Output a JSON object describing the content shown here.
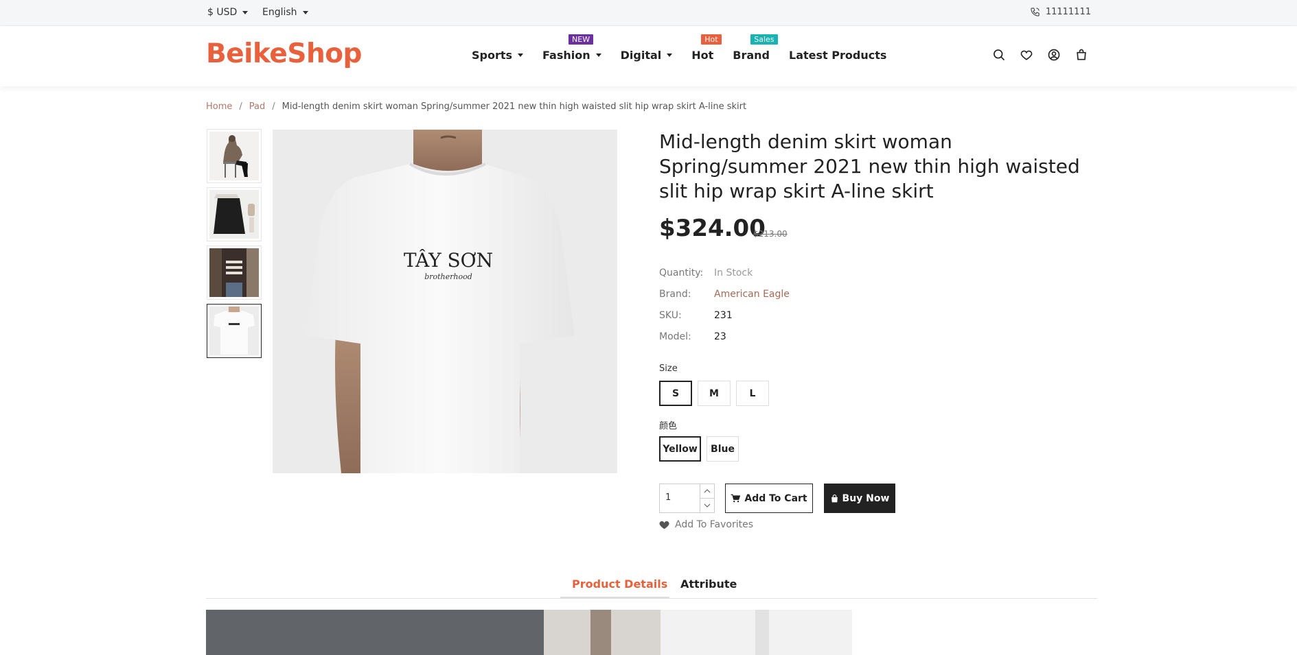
{
  "topbar": {
    "currency": "$ USD",
    "language": "English",
    "phone": "11111111"
  },
  "header": {
    "logo": "BeikeShop",
    "nav": [
      {
        "label": "Sports",
        "dropdown": true
      },
      {
        "label": "Fashion",
        "dropdown": true,
        "badge": "NEW"
      },
      {
        "label": "Digital",
        "dropdown": true
      },
      {
        "label": "Hot",
        "badge": "Hot"
      },
      {
        "label": "Brand",
        "badge": "Sales"
      },
      {
        "label": "Latest Products"
      }
    ],
    "icons": [
      "search-icon",
      "heart-icon",
      "user-icon",
      "cart-icon"
    ]
  },
  "breadcrumb": {
    "home": "Home",
    "sep": "/",
    "category": "Pad",
    "current": "Mid-length denim skirt woman Spring/summer 2021 new thin high waisted slit hip wrap skirt A-line skirt"
  },
  "product": {
    "title": "Mid-length denim skirt woman Spring/summer 2021 new thin high waisted slit hip wrap skirt A-line skirt",
    "price": "$324.00",
    "old_price": "$213.00",
    "image_text": "TÂY SƠN",
    "image_subtext": "brotherhood",
    "attributes": {
      "quantity_label": "Quantity:",
      "quantity_value": "In Stock",
      "brand_label": "Brand:",
      "brand_value": "American Eagle",
      "sku_label": "SKU:",
      "sku_value": "231",
      "model_label": "Model:",
      "model_value": "23"
    },
    "size_label": "Size",
    "sizes": [
      "S",
      "M",
      "L"
    ],
    "selected_size": "S",
    "color_label": "颜色",
    "colors": [
      "Yellow",
      "Blue"
    ],
    "selected_color": "Yellow",
    "quantity": "1",
    "add_to_cart": "Add To Cart",
    "buy_now": "Buy Now",
    "add_to_favorites": "Add To Favorites"
  },
  "tabs": {
    "details": "Product Details",
    "attribute": "Attribute"
  },
  "colors": {
    "accent": "#e8603c",
    "badge_new": "#6b2fa0",
    "badge_sales": "#19b3b3",
    "brown_link": "#a26a57"
  }
}
